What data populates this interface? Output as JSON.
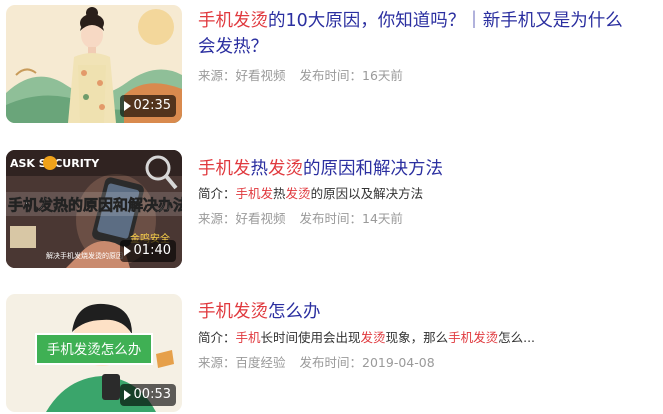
{
  "results": [
    {
      "title_parts": [
        {
          "text": "手机发烫",
          "hl": true
        },
        {
          "text": "的10大原因，你知道吗？｜新手机又是为什么会发热？",
          "hl": false
        }
      ],
      "source": "来源：好看视频",
      "time": "发布时间：16天前",
      "duration": "02:35"
    },
    {
      "title_parts": [
        {
          "text": "手机发",
          "hl": true
        },
        {
          "text": "热",
          "hl": false
        },
        {
          "text": "发烫",
          "hl": true
        },
        {
          "text": "的原因和解决方法",
          "hl": false
        }
      ],
      "summary_parts": [
        {
          "text": "简介：",
          "hl": false
        },
        {
          "text": "手机发",
          "hl": true
        },
        {
          "text": "热",
          "hl": false
        },
        {
          "text": "发烫",
          "hl": true
        },
        {
          "text": "的原因以及解决方法",
          "hl": false
        }
      ],
      "source": "来源：好看视频",
      "time": "发布时间：14天前",
      "duration": "01:40",
      "thumb_text": {
        "top": "ASK SECURITY",
        "banner": "手机发热的原因和解决办法",
        "badge": "金鸣安全",
        "caption": "解决手机发烧发烫的原因"
      }
    },
    {
      "title_parts": [
        {
          "text": "手机发烫",
          "hl": true
        },
        {
          "text": "怎么办",
          "hl": false
        }
      ],
      "summary_parts": [
        {
          "text": "简介：",
          "hl": false
        },
        {
          "text": "手机",
          "hl": true
        },
        {
          "text": "长时间使用会出现",
          "hl": false
        },
        {
          "text": "发烫",
          "hl": true
        },
        {
          "text": "现象，那么",
          "hl": false
        },
        {
          "text": "手机发烫",
          "hl": true
        },
        {
          "text": "怎么...",
          "hl": false
        }
      ],
      "source": "来源：百度经验",
      "time": "发布时间：2019-04-08",
      "duration": "00:53",
      "thumb_text": {
        "label": "手机发烫怎么办"
      }
    }
  ]
}
